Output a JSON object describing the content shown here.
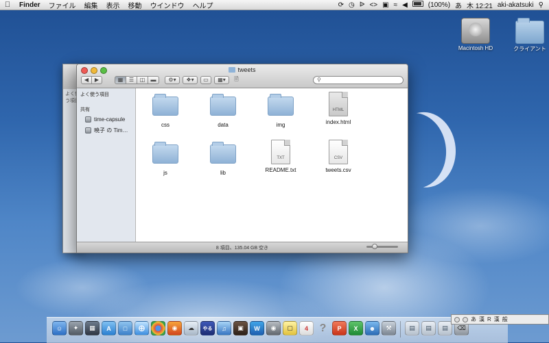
{
  "menubar": {
    "app": "Finder",
    "items": [
      "ファイル",
      "編集",
      "表示",
      "移動",
      "ウインドウ",
      "ヘルプ"
    ],
    "battery": "(100%)",
    "input_mode": "あ",
    "clock": "木 12:21",
    "user": "aki-akatsuki"
  },
  "desktop": {
    "icons": [
      {
        "label": "Macintosh HD"
      },
      {
        "label": "クライアント"
      }
    ]
  },
  "finder": {
    "title": "tweets",
    "sidebar": {
      "back_window_heading": "よく使う項目",
      "sections": [
        {
          "heading": "よく使う項目",
          "items": []
        },
        {
          "heading": "共有",
          "items": [
            "time-capsule",
            "暁子 の Tim…"
          ]
        }
      ]
    },
    "items": [
      {
        "name": "css",
        "kind": "folder"
      },
      {
        "name": "data",
        "kind": "folder"
      },
      {
        "name": "img",
        "kind": "folder"
      },
      {
        "name": "index.html",
        "kind": "doc",
        "tag": "HTML"
      },
      {
        "name": "js",
        "kind": "folder"
      },
      {
        "name": "lib",
        "kind": "folder"
      },
      {
        "name": "README.txt",
        "kind": "doc",
        "tag": "TXT"
      },
      {
        "name": "tweets.csv",
        "kind": "doc",
        "tag": "CSV"
      }
    ],
    "status": "8 項目、135.04 GB 空き"
  },
  "ime_palette": {
    "labels": [
      "あ",
      "漢",
      "R",
      "漢",
      "般"
    ]
  },
  "colors": {
    "desktop_top": "#1f4f93",
    "folder_blue": "#8fb2d6",
    "close": "#ef5b55",
    "minimize": "#f0b93a",
    "zoom": "#59bf45"
  }
}
